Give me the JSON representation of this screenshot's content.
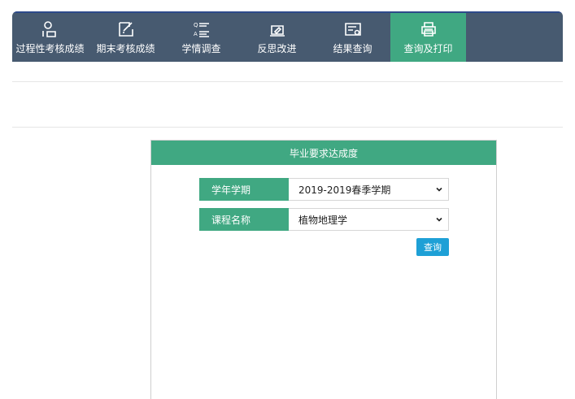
{
  "nav": {
    "items": [
      {
        "label": "过程性考核成绩",
        "icon": "user-group-icon"
      },
      {
        "label": "期末考核成绩",
        "icon": "edit-note-icon"
      },
      {
        "label": "学情调查",
        "icon": "qa-list-icon"
      },
      {
        "label": "反思改进",
        "icon": "laptop-edit-icon"
      },
      {
        "label": "结果查询",
        "icon": "result-card-icon"
      },
      {
        "label": "查询及打印",
        "icon": "printer-icon"
      }
    ],
    "active_index": 5
  },
  "panel": {
    "title": "毕业要求达成度",
    "semester_label": "学年学期",
    "semester_value": "2019-2019春季学期",
    "course_label": "课程名称",
    "course_value": "植物地理学",
    "query_button": "查询"
  },
  "colors": {
    "nav_bg": "#475a70",
    "accent_green": "#40a882",
    "button_blue": "#1ea0d6"
  }
}
